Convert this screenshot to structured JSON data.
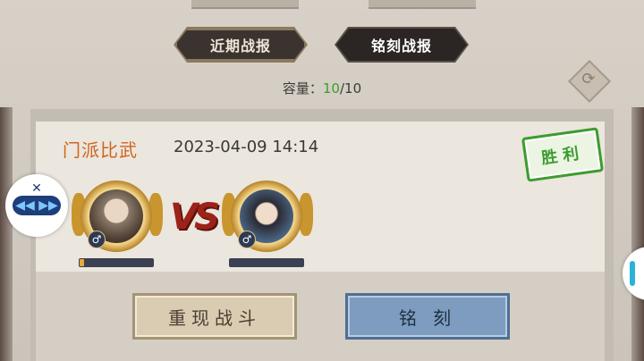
{
  "tabs": {
    "recent_label": "近期战报",
    "engraved_label": "铭刻战报"
  },
  "capacity": {
    "label": "容量：",
    "current": "10",
    "max": "/10"
  },
  "battle": {
    "mode": "门派比武",
    "datetime": "2023-04-09 14:14",
    "result": "胜利",
    "vs_text": "VS",
    "player_left": {
      "gender": "♂",
      "hp_fraction": 0.06
    },
    "player_right": {
      "gender": "♂",
      "hp_fraction": 0.0
    }
  },
  "actions": {
    "replay_label": "重现战斗",
    "engrave_label": "铭 刻"
  },
  "colors": {
    "accent_orange": "#d0641f",
    "victory_green": "#3c9c2f",
    "capacity_green": "#3f9c2a"
  },
  "icons": {
    "refresh": "refresh-icon",
    "gender": "male-icon"
  }
}
